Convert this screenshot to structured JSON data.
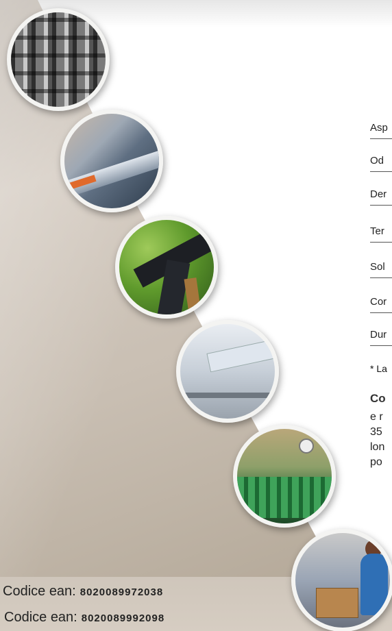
{
  "specs": [
    {
      "label": "Asp"
    },
    {
      "label": "Od"
    },
    {
      "label": "Der"
    },
    {
      "label": "Ter"
    },
    {
      "label": "Sol"
    },
    {
      "label": "Cor"
    },
    {
      "label": "Dur"
    }
  ],
  "note": "* La",
  "paragraph": {
    "line1": "Co",
    "line2": "e r",
    "line3": "35",
    "line4": "lon",
    "line5": "po"
  },
  "codes": [
    {
      "label": "Codice ean:",
      "value": "8020089972038"
    },
    {
      "label": "Codice ean:",
      "value": "8020089992098"
    }
  ],
  "images": [
    {
      "icon": "chain-photo"
    },
    {
      "icon": "lubrication-photo"
    },
    {
      "icon": "bicycle-photo"
    },
    {
      "icon": "machinery-photo"
    },
    {
      "icon": "bottling-line-photo"
    },
    {
      "icon": "packaging-worker-photo"
    }
  ]
}
